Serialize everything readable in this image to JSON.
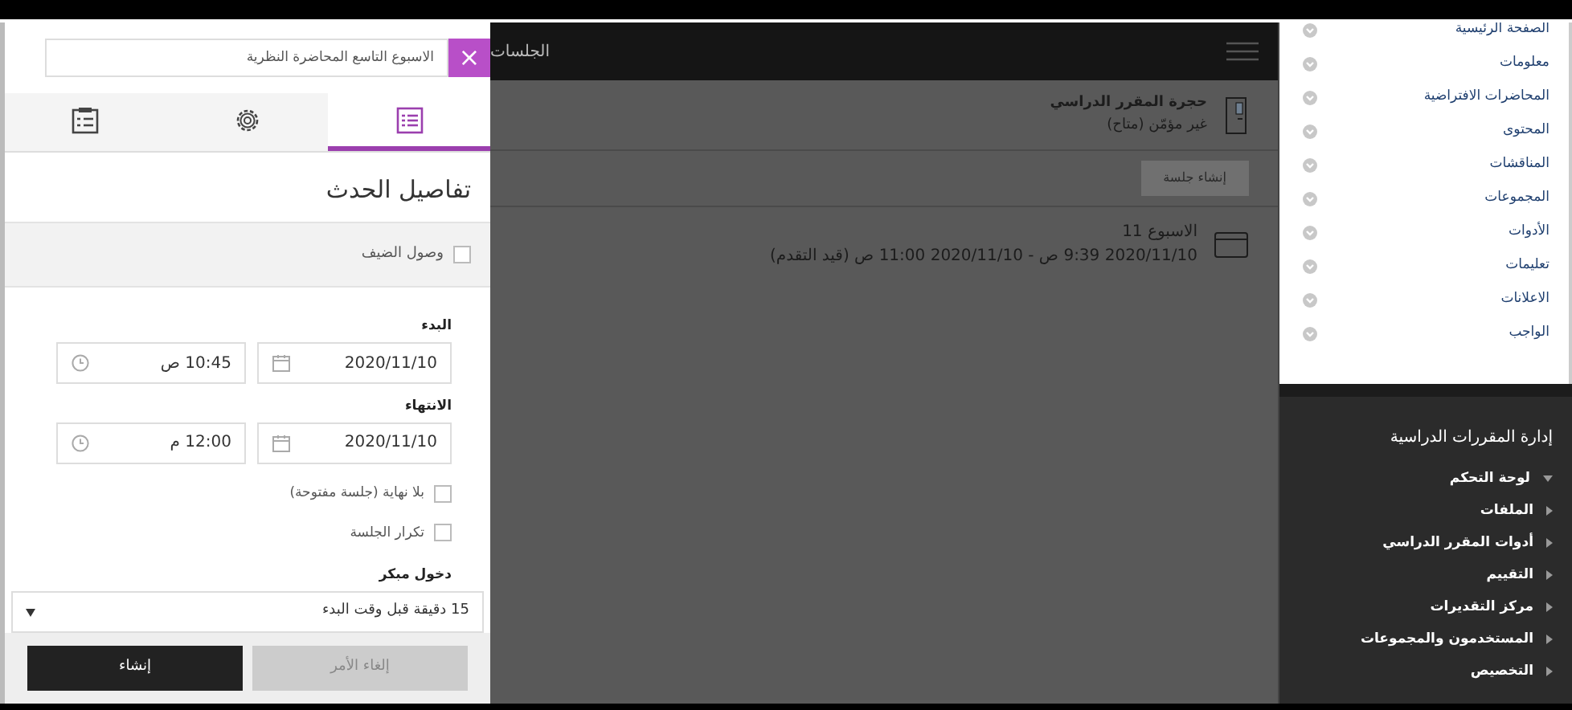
{
  "form": {
    "title_value": "الاسبوع التاسع المحاضرة النظرية",
    "close_label": "×",
    "tabs": [
      {
        "kind": "details",
        "selected": true
      },
      {
        "kind": "settings",
        "selected": false
      },
      {
        "kind": "attendance",
        "selected": false
      }
    ],
    "heading": "تفاصيل الحدث",
    "guest_access": {
      "label": "وصول الضيف",
      "checked": false
    },
    "start": {
      "label": "البدء",
      "date": "2020/11/10",
      "time": "10:45 ص"
    },
    "end": {
      "label": "الانتهاء",
      "date": "2020/11/10",
      "time": "12:00 م"
    },
    "options": [
      {
        "label": "بلا نهاية (جلسة مفتوحة)",
        "checked": false
      },
      {
        "label": "تكرار الجلسة",
        "checked": false
      }
    ],
    "early_entry": {
      "label": "دخول مبكر",
      "value": "15 دقيقة قبل وقت البدء"
    },
    "buttons": [
      {
        "label": "إلغاء الأمر",
        "kind": "secondary"
      },
      {
        "label": "إنشاء",
        "kind": "primary"
      }
    ]
  },
  "sessions": {
    "title": "الجلسات",
    "course_room": {
      "name": "حجرة المقرر الدراسي",
      "status": "غير مؤمّن (متاح)"
    },
    "create_button": "إنشاء جلسة",
    "items": [
      {
        "name": "الاسبوع 11",
        "time": "2020/11/10 9:39 ص - 2020/11/10 11:00 ص (قيد التقدم)"
      }
    ]
  },
  "course_menu": {
    "items": [
      "الصفحة الرئيسية",
      "معلومات",
      "المحاضرات الافتراضية",
      "المحتوى",
      "المناقشات",
      "المجموعات",
      "الأدوات",
      "تعليمات",
      "الاعلانات",
      "الواجب"
    ],
    "management": {
      "title": "إدارة المقررات الدراسية",
      "items": [
        {
          "label": "لوحة التحكم",
          "expanded": true
        },
        {
          "label": "الملفات",
          "expanded": false
        },
        {
          "label": "أدوات المقرر الدراسي",
          "expanded": false
        },
        {
          "label": "التقييم",
          "expanded": false
        },
        {
          "label": "مركز التقديرات",
          "expanded": false
        },
        {
          "label": "المستخدمون والمجموعات",
          "expanded": false
        },
        {
          "label": "التخصيص",
          "expanded": false
        }
      ]
    }
  }
}
